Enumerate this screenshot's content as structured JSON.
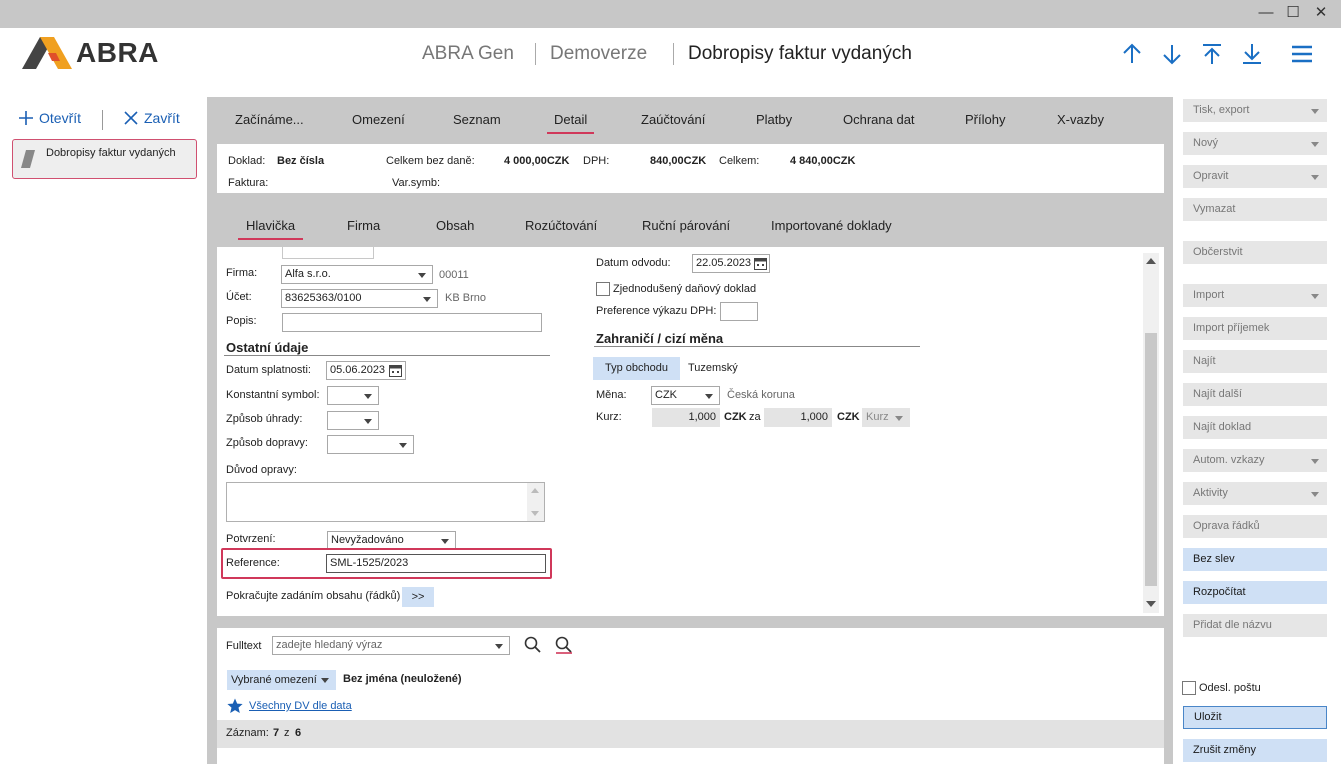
{
  "window": {
    "minimize_icon": "minimize-icon",
    "maximize_icon": "maximize-icon",
    "close_icon": "close-icon"
  },
  "header": {
    "logo_text": "ABRA",
    "app": "ABRA Gen",
    "env": "Demoverze",
    "title": "Dobropisy faktur vydaných",
    "nav_icons": [
      "arrow-up-icon",
      "arrow-down-icon",
      "arrow-top-icon",
      "arrow-bottom-icon",
      "menu-icon"
    ]
  },
  "left_panel": {
    "open_label": "Otevřít",
    "close_label": "Zavřít",
    "item_label": "Dobropisy faktur vydaných"
  },
  "main_tabs": [
    "Začínáme...",
    "Omezení",
    "Seznam",
    "Detail",
    "Zaúčtování",
    "Platby",
    "Ochrana dat",
    "Přílohy",
    "X-vazby"
  ],
  "info": {
    "doklad_label": "Doklad:",
    "doklad_value": "Bez čísla",
    "bez_dane_label": "Celkem bez daně:",
    "bez_dane_value": "4 000,00CZK",
    "dph_label": "DPH:",
    "dph_value": "840,00CZK",
    "celkem_label": "Celkem:",
    "celkem_value": "4 840,00CZK",
    "faktura_label": "Faktura:",
    "varsymb_label": "Var.symb:"
  },
  "sub_tabs": [
    "Hlavička",
    "Firma",
    "Obsah",
    "Rozúčtování",
    "Ruční párování",
    "Importované doklady"
  ],
  "form": {
    "firma_label": "Firma:",
    "firma_value": "Alfa s.r.o.",
    "firma_code": "00011",
    "ucet_label": "Účet:",
    "ucet_value": "83625363/0100",
    "ucet_bank": "KB Brno",
    "popis_label": "Popis:",
    "ostatni_header": "Ostatní údaje",
    "splatnost_label": "Datum splatnosti:",
    "splatnost_value": "05.06.2023",
    "konst_label": "Konstantní symbol:",
    "uhrada_label": "Způsob úhrady:",
    "doprava_label": "Způsob dopravy:",
    "duvod_label": "Důvod opravy:",
    "potvrzeni_label": "Potvrzení:",
    "potvrzeni_value": "Nevyžadováno",
    "reference_label": "Reference:",
    "reference_value": "SML-1525/2023",
    "pokracujte_label": "Pokračujte zadáním obsahu (řádků)",
    "pokracujte_btn": ">>",
    "odvod_label": "Datum odvodu:",
    "odvod_value": "22.05.2023",
    "zjednoduseny_label": "Zjednodušený daňový doklad",
    "preference_label": "Preference výkazu DPH:",
    "zahranici_header": "Zahraničí / cizí měna",
    "typ_obchodu_btn": "Typ obchodu",
    "typ_obchodu_value": "Tuzemský",
    "mena_label": "Měna:",
    "mena_value": "CZK",
    "mena_name": "Česká koruna",
    "kurz_label": "Kurz:",
    "kurz_value1": "1,000",
    "kurz_cur1": "CZK",
    "kurz_za": "za",
    "kurz_value2": "1,000",
    "kurz_cur2": "CZK",
    "kurz_select": "Kurz"
  },
  "filter": {
    "fulltext_label": "Fulltext",
    "fulltext_placeholder": "zadejte hledaný výraz",
    "omezeni_select": "Vybrané omezení",
    "omezeni_value": "Bez jména (neuložené)",
    "link": "Všechny DV dle data",
    "zaznam_label": "Záznam:",
    "zaznam_value": "7",
    "zaznam_of": "z",
    "zaznam_total": "6"
  },
  "actions": [
    "Tisk, export",
    "Nový",
    "Opravit",
    "Vymazat",
    "Občerstvit",
    "Import",
    "Import příjemek",
    "Najít",
    "Najít další",
    "Najít doklad",
    "Autom. vzkazy",
    "Aktivity",
    "Oprava řádků",
    "Bez slev",
    "Rozpočítat",
    "Přidat dle názvu"
  ],
  "bottom_actions": {
    "odesl_label": "Odesl. poštu",
    "save": "Uložit",
    "cancel": "Zrušit změny"
  },
  "colors": {
    "accent": "#d0385a",
    "link": "#1a5fb4",
    "highlight": "#cfe0f5"
  }
}
